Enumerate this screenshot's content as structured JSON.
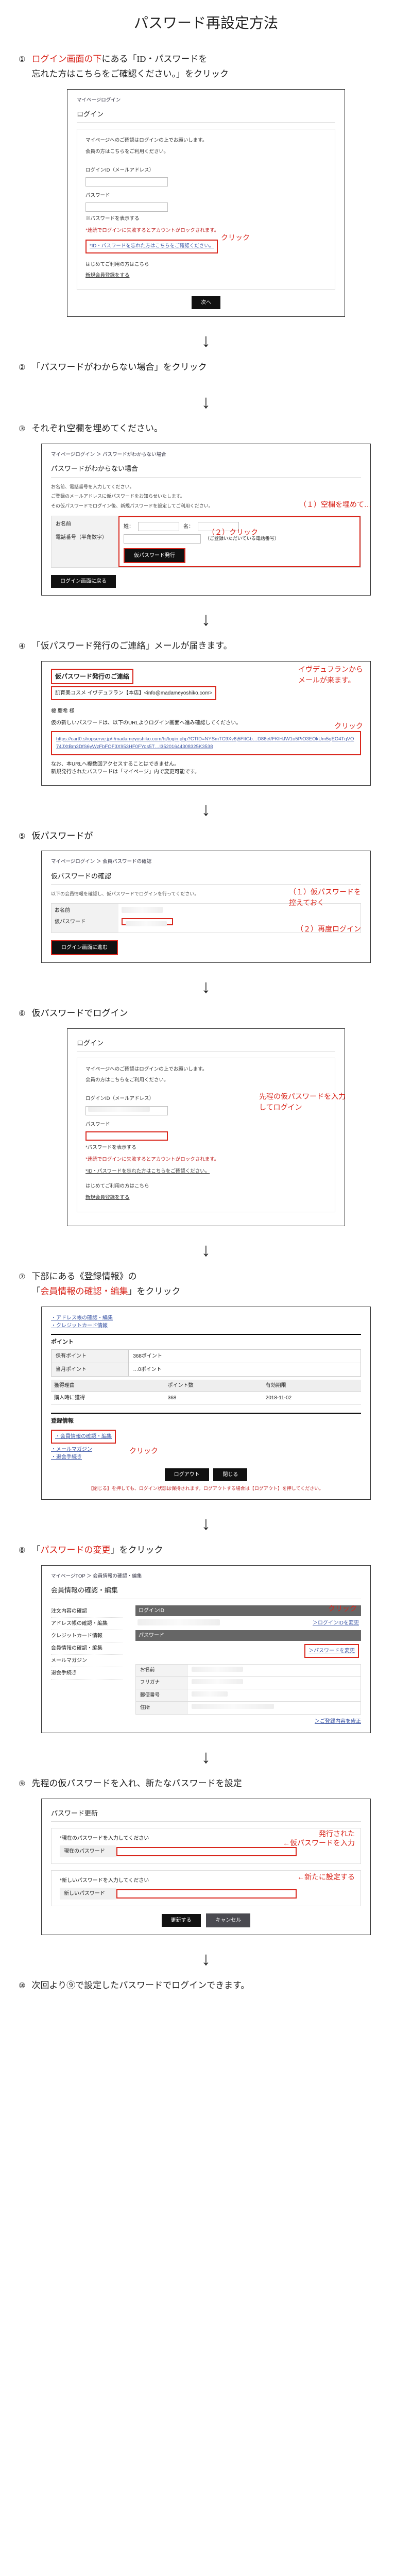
{
  "title": "パスワード再設定方法",
  "steps": {
    "s1": {
      "num": "①",
      "pre": "ログイン画面の下",
      "main1": "にある「ID・パスワードを",
      "main2": "忘れた方はこちらをご確認ください。」をクリック"
    },
    "s2": {
      "num": "②",
      "text": "「パスワードがわからない場合」をクリック"
    },
    "s3": {
      "num": "③",
      "text": "それぞれ空欄を埋めてください。"
    },
    "s4": {
      "num": "④",
      "text": "「仮パスワード発行のご連絡」メールが届きます。"
    },
    "s5": {
      "num": "⑤",
      "text": "仮パスワードが"
    },
    "s6": {
      "num": "⑥",
      "text": "仮パスワードでログイン"
    },
    "s7": {
      "num": "⑦",
      "line1": "下部にある《登録情報》の",
      "line2a": "「",
      "line2red": "会員情報の確認・編集",
      "line2b": "」をクリック"
    },
    "s8": {
      "num": "⑧",
      "line_a": "「",
      "line_red": "パスワードの変更",
      "line_b": "」をクリック"
    },
    "s9": {
      "num": "⑨",
      "text": "先程の仮パスワードを入れ、新たなパスワードを設定"
    },
    "s10": {
      "num": "⑩",
      "text": "次回より⑨で設定したパスワードでログインできます。"
    }
  },
  "annotations": {
    "click": "クリック",
    "fill_blank": "（１）空欄を埋めて…",
    "click2": "（２）クリック",
    "mail_from": "イヴデュフランから\nメールが来ます。",
    "temp_pw_note": "（１）仮パスワードを\n控えておく",
    "relogin": "（２）再度ログイン",
    "enter_temp": "先程の仮パスワードを入力\nしてログイン",
    "issued": "発行された",
    "enter_temp2": "←仮パスワードを入力",
    "set_new": "←新たに設定する"
  },
  "panel1": {
    "breadcrumb_a": "マイページログイン",
    "h": "ログイン",
    "lead1": "マイページへのご確認はログインの上でお願いします。",
    "lead2": "会員の方はこちらをご利用ください。",
    "id_label": "ログインID（メールアドレス）",
    "pw_label": "パスワード",
    "note1": "※パスワードを表示する",
    "warn_red": "*連続でログインに失敗するとアカウントがロックされます。",
    "id_pw_help": "*ID・パスワードを忘れた方はこちらをご確認ください。",
    "first_time": "はじめてご利用の方はこちら",
    "new_member": "新規会員登録をする",
    "go_next": "次へ"
  },
  "panel3": {
    "bc": "マイページログイン ＞ パスワードがわからない場合",
    "h": "パスワードがわからない場合",
    "p1": "お名前、電話番号を入力してください。",
    "p2": "ご登録のメールアドレスに仮パスワードをお知らせいたします。",
    "p3": "その仮パスワードでログイン後、新規パスワードを設定してご利用ください。",
    "row_name": "お名前",
    "sei": "姓：",
    "mei": "名：",
    "row_tel": "電話番号（半角数字）",
    "tel_note": "（ご登録いただいている電話番号）",
    "btn_temp": "仮パスワード発行",
    "btn_back": "ログイン画面に戻る"
  },
  "panel4": {
    "subject_label": "仮パスワード発行のご連絡",
    "from_label": "肌育美コスメ イヴデュフラン【本店】<info@madameyoshiko.com>",
    "greeting": "榎 慶希 様",
    "line1": "仮の新しいパスワードは、以下のURLよりログイン画面へ進み確認してください。",
    "url_text": "https://cart0.shopserve.jp/-/madameyoshiko.com/hj/login.php?CTID=NYSmTC9Xv6j5FItGb…D86et/FKlHJW1o5PiO3EOkUm5qEO4TqVO74JXtBm3DfS6yWzFbFOF3X953HF0FYos5T…l35201644308325K3538",
    "caution1": "なお、本URLへ複数回アクセスすることはできません。",
    "caution2": "新規発行されたパスワードは「マイページ」内で変更可能です。"
  },
  "panel5": {
    "bc": "マイページログイン ＞ 会員パスワードの確認",
    "h": "仮パスワードの確認",
    "lead": "以下の会員情報を確認し、仮パスワードでログインを行ってください。",
    "row_name": "お名前",
    "row_temp": "仮パスワード",
    "btn": "ログイン画面に進む"
  },
  "panel6": {
    "h": "ログイン",
    "lead1": "マイページへのご確認はログインの上でお願いします。",
    "lead2": "会員の方はこちらをご利用ください。",
    "id_label": "ログインID（メールアドレス）",
    "pw_label": "パスワード",
    "show_pw": "*パスワードを表示する",
    "warn_red": "*連続でログインに失敗するとアカウントがロックされます。",
    "id_pw_help": "*ID・パスワードを忘れた方はこちらをご確認ください。",
    "first_time": "はじめてご利用の方はこちら",
    "new_member": "新規会員登録をする"
  },
  "panel7": {
    "link_addr": "・アドレス帳の確認・編集",
    "link_cc": "・クレジットカード情報",
    "h_point": "ポイント",
    "pt_row1_l": "保有ポイント",
    "pt_row1_r": "368ポイント",
    "pt_row2_l": "当月ポイント",
    "pt_row2_r": "…0ポイント",
    "hist_h1": "獲得理由",
    "hist_h2": "ポイント数",
    "hist_h3": "有効期限",
    "hist_r1": "購入時に獲得",
    "hist_r2": "368",
    "hist_r3": "2018-11-02",
    "h_reg": "登録情報",
    "link_member": "・会員情報の確認・編集",
    "link_mail": "・メールマガジン",
    "link_leave": "・退会手続き",
    "btn_logout": "ログアウト",
    "btn_close": "閉じる",
    "warn": "【閉じる】を押しても、ログイン状態は保持されます。ログアウトする場合は【ログアウト】を押してください。"
  },
  "panel8": {
    "bc": "マイページTOP ＞ 会員情報の確認・編集",
    "h": "会員情報の確認・編集",
    "nav1": "注文内容の確認",
    "nav2": "アドレス帳の確認・編集",
    "nav3": "クレジットカード情報",
    "nav4": "会員情報の確認・編集",
    "nav5": "メールマガジン",
    "nav6": "退会手続き",
    "label_id": "ログインID",
    "right_id_link": "＞ログインIDを変更",
    "label_pw": "パスワード",
    "right_pw_link": "＞パスワードを変更",
    "row_name": "お名前",
    "row_kana": "フリガナ",
    "row_zip": "郵便番号",
    "row_addr": "住所",
    "edit_link": "＞ご登録内容を修正"
  },
  "panel9": {
    "h": "パスワード更新",
    "sec1_lead": "*現在のパスワードを入力してください",
    "label_cur": "現在のパスワード",
    "sec2_lead": "*新しいパスワードを入力してください",
    "label_new": "新しいパスワード",
    "btn_update": "更新する",
    "btn_cancel": "キャンセル"
  }
}
